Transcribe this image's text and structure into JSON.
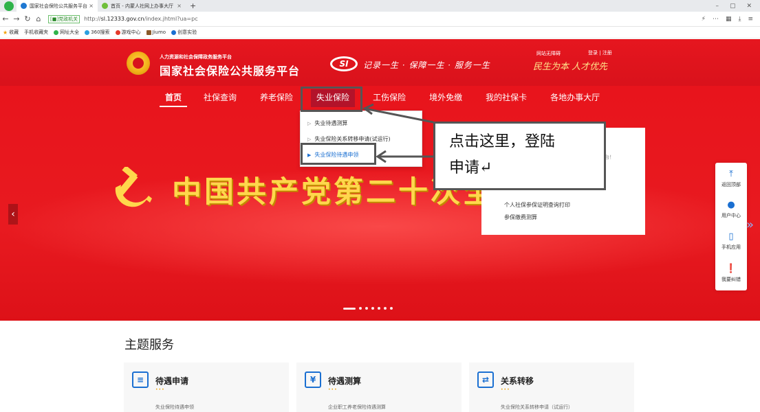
{
  "browser": {
    "tabs": [
      {
        "label": "国家社会保险公共服务平台",
        "active": true
      },
      {
        "label": "首页 - 内蒙人社网上办事大厅",
        "active": false
      }
    ],
    "url_badge": "[■]党政机关",
    "url_domain": "sl.12333.gov.cn",
    "url_prefix": "http://",
    "url_suffix": "/index.jhtml?ua=pc",
    "bookmarks": [
      "收藏",
      "手机收藏夹",
      "网址大全",
      "360搜索",
      "游戏中心",
      "Jiumo",
      "创意实验"
    ]
  },
  "header": {
    "subtitle": "人力资源和社会保障政务服务平台",
    "title": "国家社会保险公共服务平台",
    "si_logo": "SI",
    "slogan": "记录一生 · 保障一生 · 服务一生",
    "accessible": "网站无障碍",
    "login": "登录 | 注册",
    "motto": "民生为本 人才优先"
  },
  "nav": {
    "items": [
      "首页",
      "社保查询",
      "养老保险",
      "失业保险",
      "工伤保险",
      "境外免缴",
      "我的社保卡",
      "各地办事大厅"
    ]
  },
  "dropdown": {
    "items": [
      "失业待遇测算",
      "失业保险关系转移申请(试运行)",
      "失业保险待遇申领"
    ]
  },
  "hero": {
    "banner": "中国共产党第二十次全",
    "prev": "‹",
    "next": "»"
  },
  "login_card": {
    "text": "平台！",
    "link1": "个人社保参保证明查询打印",
    "link2": "参保缴费测算"
  },
  "annotation": {
    "line1": "点击这里，登陆",
    "line2": "申请↵"
  },
  "float_bar": {
    "items": [
      "返回顶部",
      "用户中心",
      "手机应用",
      "我要纠错"
    ]
  },
  "services": {
    "title": "主题服务",
    "cards": [
      {
        "title": "待遇申请",
        "desc": "失业保险待遇申领"
      },
      {
        "title": "待遇测算",
        "desc": "企业职工养老保险待遇测算"
      },
      {
        "title": "关系转移",
        "desc": "失业保险关系转移申请（试运行）"
      }
    ]
  }
}
